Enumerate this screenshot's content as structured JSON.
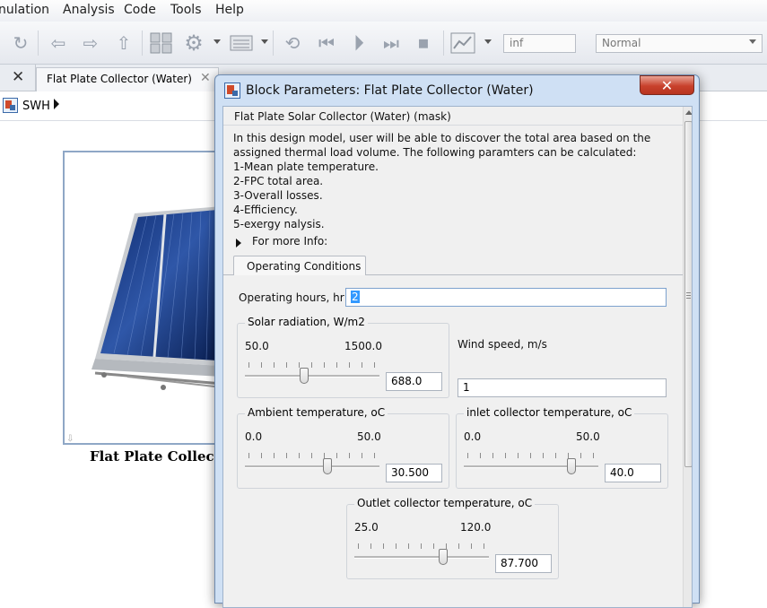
{
  "menu": [
    "nulation",
    "Analysis",
    "Code",
    "Tools",
    "Help"
  ],
  "toolbar": {
    "stop_time": "inf",
    "sim_mode": "Normal"
  },
  "tabs": {
    "active_tab": "Flat Plate Collector (Water)"
  },
  "breadcrumb": {
    "model": "SWH"
  },
  "canvas": {
    "block_label": "Flat Plate Collecto"
  },
  "dialog": {
    "title": "Block Parameters: Flat Plate Collector (Water)",
    "mask_header": "Flat Plate Solar Collector (Water)  (mask)",
    "description": [
      "In this design model, user will be able to discover the total area based on the",
      "assigned thermal load volume. The following paramters can be calculated:",
      "1-Mean plate temperature.",
      "2-FPC total area.",
      "3-Overall losses.",
      "4-Efficiency.",
      "5-exergy nalysis."
    ],
    "more_info": "For more Info:",
    "tab_label": "Operating Conditions",
    "operating_hours": {
      "label": "Operating hours, hr",
      "value": "2"
    },
    "wind_speed": {
      "label": "Wind speed, m/s",
      "value": "1"
    },
    "solar_radiation": {
      "title": "Solar radiation, W/m2",
      "min": "50.0",
      "max": "1500.0",
      "value": "688.0",
      "fraction": 0.44
    },
    "ambient_temperature": {
      "title": "Ambient temperature, oC",
      "min": "0.0",
      "max": "50.0",
      "value": "30.500",
      "fraction": 0.61
    },
    "inlet_temperature": {
      "title": "inlet collector temperature, oC",
      "min": "0.0",
      "max": "50.0",
      "value": "40.0",
      "fraction": 0.8
    },
    "outlet_temperature": {
      "title": "Outlet collector temperature, oC",
      "min": "25.0",
      "max": "120.0",
      "value": "87.700",
      "fraction": 0.66
    }
  }
}
